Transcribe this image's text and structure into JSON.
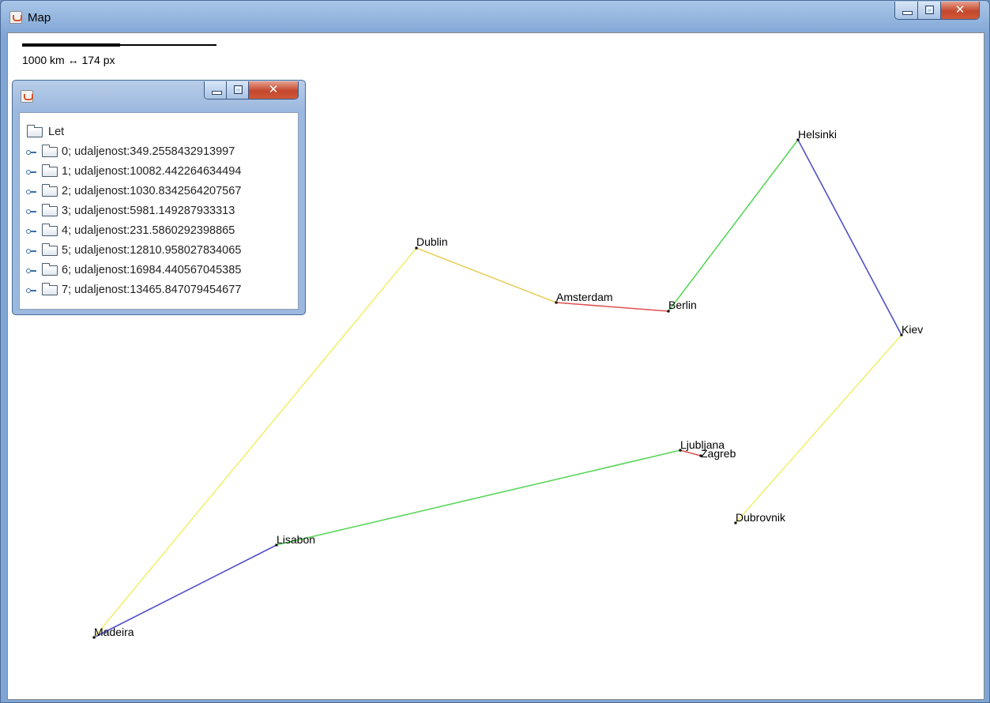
{
  "window": {
    "title": "Map",
    "icon": "java-coffee-cup-icon"
  },
  "scale": {
    "label": "1000 km ↔ 174 px"
  },
  "map": {
    "cities": [
      {
        "id": "helsinki",
        "name": "Helsinki"
      },
      {
        "id": "dublin",
        "name": "Dublin"
      },
      {
        "id": "amsterdam",
        "name": "Amsterdam"
      },
      {
        "id": "berlin",
        "name": "Berlin"
      },
      {
        "id": "kiev",
        "name": "Kiev"
      },
      {
        "id": "ljubljana",
        "name": "Ljubljana"
      },
      {
        "id": "zagreb",
        "name": "Zagreb"
      },
      {
        "id": "dubrovnik",
        "name": "Dubrovnik"
      },
      {
        "id": "lisabon",
        "name": "Lisabon"
      },
      {
        "id": "madeira",
        "name": "Madeira"
      }
    ],
    "routes": [
      {
        "from": "amsterdam",
        "to": "berlin",
        "color": "#e05050"
      },
      {
        "from": "berlin",
        "to": "helsinki",
        "color": "#5ad65a"
      },
      {
        "from": "helsinki",
        "to": "kiev",
        "color": "#5050c8"
      },
      {
        "from": "kiev",
        "to": "dubrovnik",
        "color": "#f0f070"
      },
      {
        "from": "ljubljana",
        "to": "zagreb",
        "color": "#e05050"
      },
      {
        "from": "lisabon",
        "to": "ljubljana",
        "color": "#5ad65a"
      },
      {
        "from": "madeira",
        "to": "lisabon",
        "color": "#5050c8"
      },
      {
        "from": "dublin",
        "to": "madeira",
        "color": "#f0f070"
      },
      {
        "from": "dublin",
        "to": "amsterdam",
        "color": "#e8cf60"
      }
    ]
  },
  "tree_window": {
    "root": "Let",
    "items": [
      "0; udaljenost:349.2558432913997",
      "1; udaljenost:10082.442264634494",
      "2; udaljenost:1030.8342564207567",
      "3; udaljenost:5981.149287933313",
      "4; udaljenost:231.5860292398865",
      "5; udaljenost:12810.958027834065",
      "6; udaljenost:16984.440567045385",
      "7; udaljenost:13465.847079454677"
    ]
  }
}
